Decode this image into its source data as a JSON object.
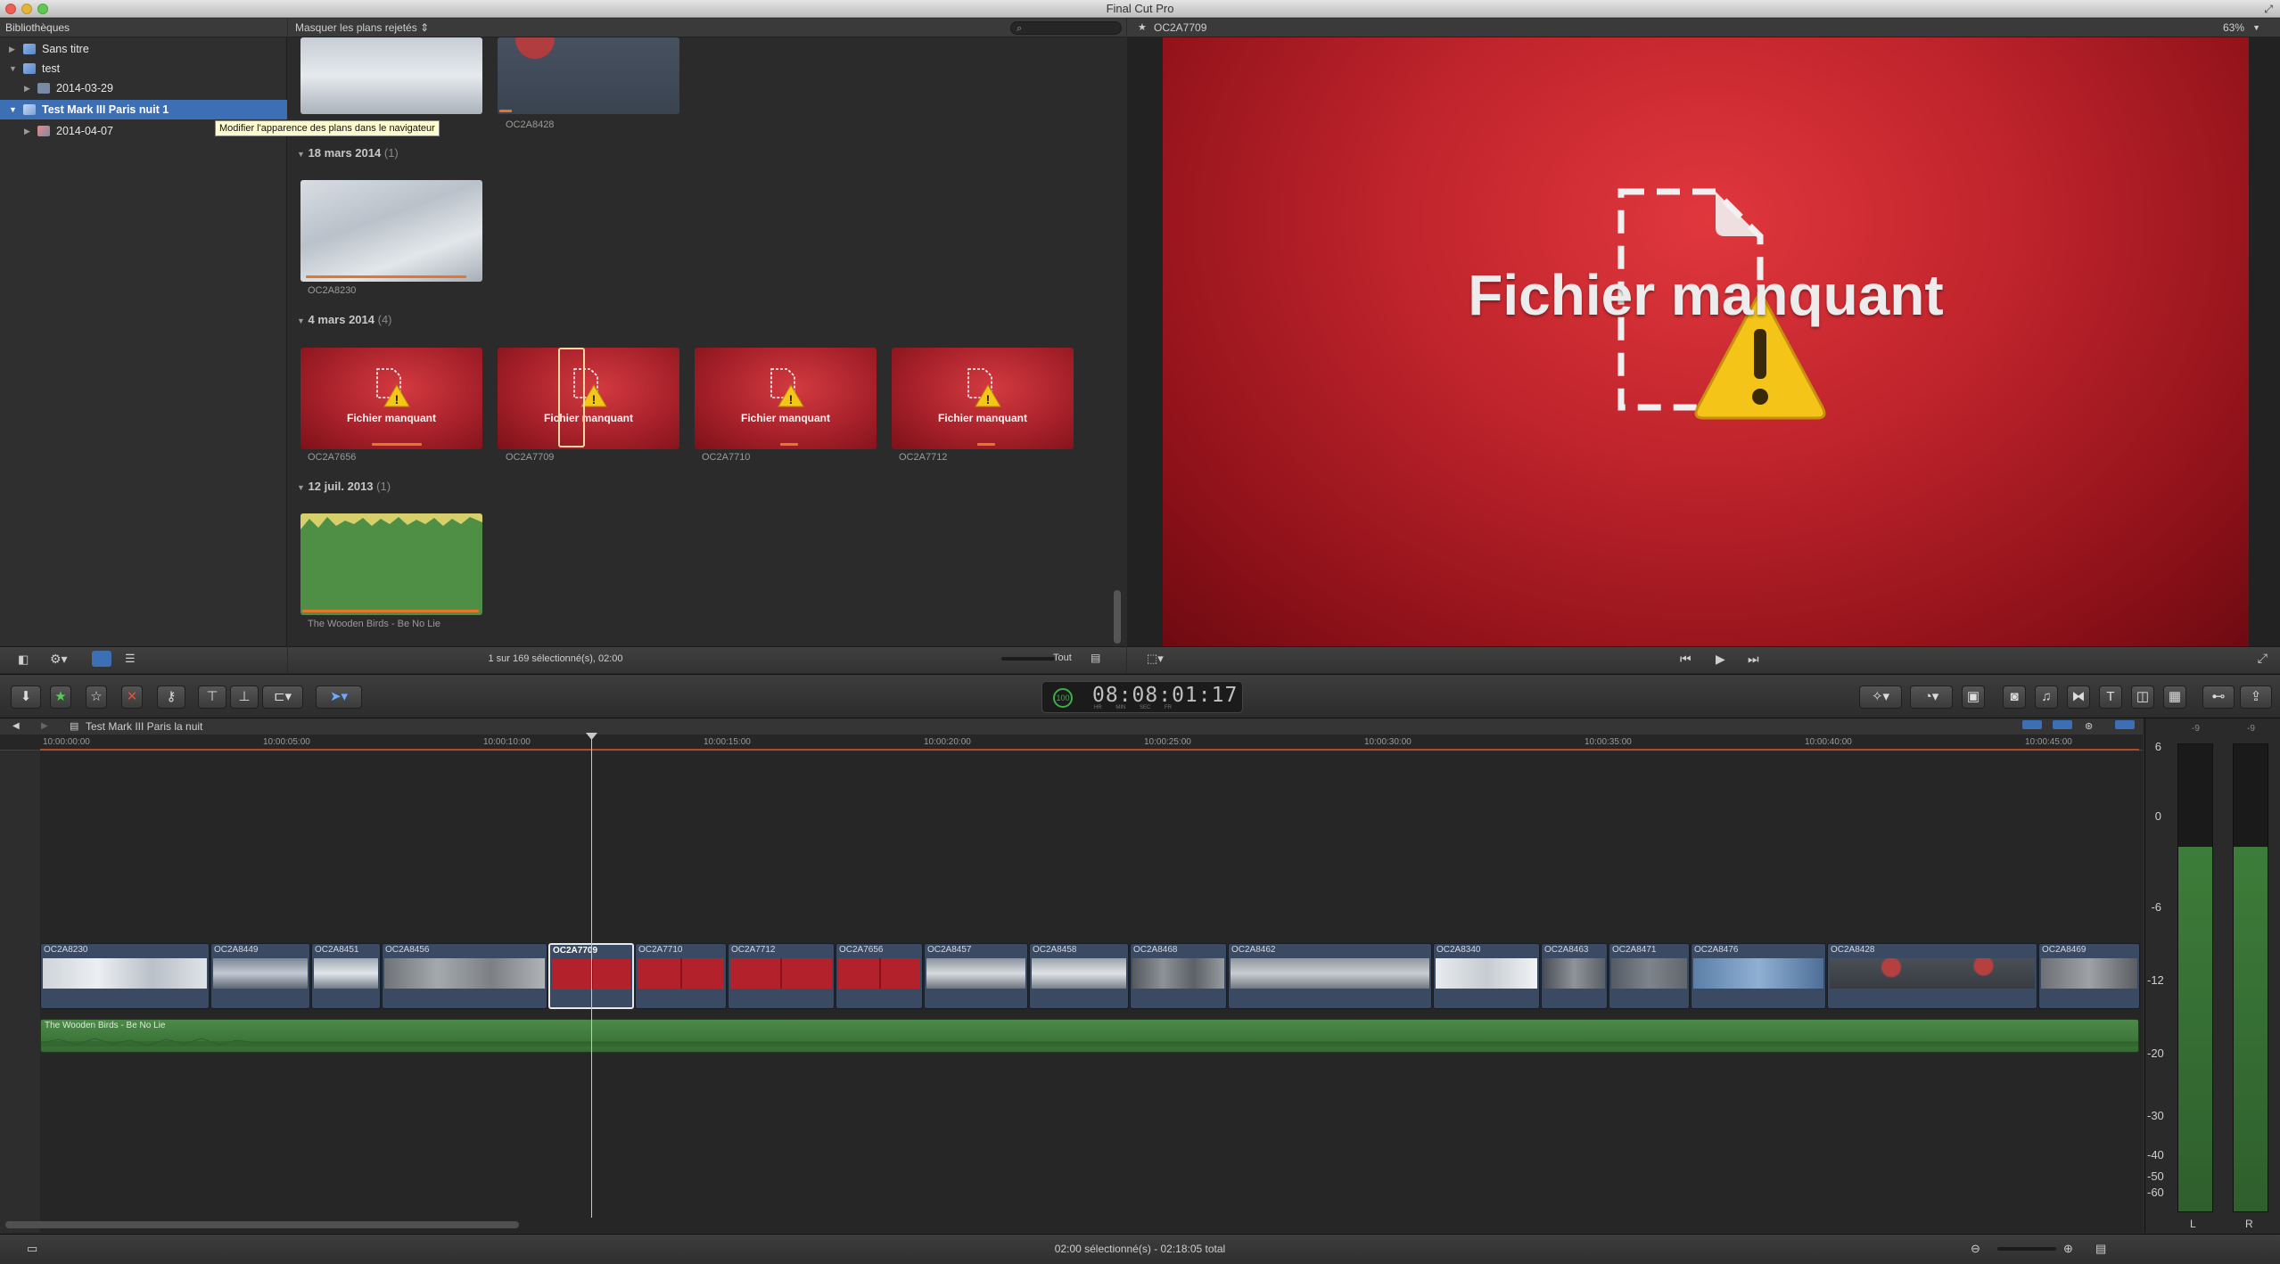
{
  "app": {
    "title": "Final Cut Pro"
  },
  "library": {
    "header": "Bibliothèques",
    "items": [
      {
        "label": "Sans titre"
      },
      {
        "label": "test"
      },
      {
        "label": "2014-03-29"
      },
      {
        "label": "Test Mark III Paris nuit 1"
      },
      {
        "label": "2014-04-07"
      }
    ],
    "tooltip": "Modifier l'apparence des plans dans le navigateur"
  },
  "browser": {
    "filter": "Masquer les plans rejetés",
    "top_clips": [
      "OC2A8428"
    ],
    "groups": [
      {
        "date": "18 mars 2014",
        "count": "(1)",
        "clips": [
          "OC2A8230"
        ]
      },
      {
        "date": "4 mars 2014",
        "count": "(4)",
        "clips": [
          "OC2A7656",
          "OC2A7709",
          "OC2A7710",
          "OC2A7712"
        ]
      },
      {
        "date": "12 juil. 2013",
        "count": "(1)",
        "clips": [
          "The Wooden Birds - Be No Lie"
        ]
      }
    ],
    "missing_label": "Fichier manquant",
    "selection_info": "1 sur 169 sélectionné(s), 02:00",
    "filter_all": "Tout"
  },
  "viewer": {
    "clip_name": "OC2A7709",
    "zoom": "63%",
    "missing_text": "Fichier manquant"
  },
  "toolbar": {
    "timecode": "08:08:01:17",
    "timecode_badge": "100",
    "timecode_units": [
      "HR",
      "MIN",
      "SEC",
      "FR"
    ]
  },
  "timeline": {
    "project": "Test Mark III Paris la nuit",
    "ruler": [
      "10:00:00:00",
      "10:00:05:00",
      "10:00:10:00",
      "10:00:15:00",
      "10:00:20:00",
      "10:00:25:00",
      "10:00:30:00",
      "10:00:35:00",
      "10:00:40:00",
      "10:00:45:00"
    ],
    "clips": [
      "OC2A8230",
      "OC2A8449",
      "OC2A8451",
      "OC2A8456",
      "OC2A7709",
      "OC2A7710",
      "OC2A7712",
      "OC2A7656",
      "OC2A8457",
      "OC2A8458",
      "OC2A8468",
      "OC2A8462",
      "OC2A8340",
      "OC2A8463",
      "OC2A8471",
      "OC2A8476",
      "OC2A8428",
      "OC2A8469"
    ],
    "audio_clip": "The Wooden Birds - Be No Lie"
  },
  "meters": {
    "scale": [
      "6",
      "0",
      "-6",
      "-12",
      "-20",
      "-30",
      "-40",
      "-50",
      "-60"
    ],
    "top_labels": [
      "-9",
      "-9"
    ],
    "channels": [
      "L",
      "R"
    ],
    "level": 0.78
  },
  "status": {
    "text": "02:00 sélectionné(s) - 02:18:05 total"
  },
  "colors": {
    "accent": "#3d6fb4",
    "missing_red": "#c0242c",
    "audio_green": "#4c8a48",
    "clip_blue": "#3a4a63",
    "orange_marker": "#e4762b"
  }
}
